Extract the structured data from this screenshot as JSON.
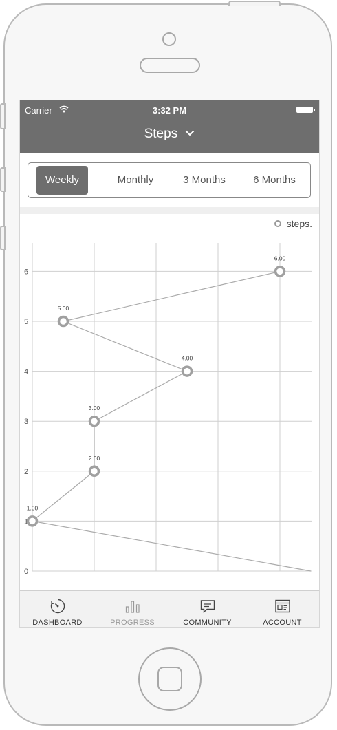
{
  "status_bar": {
    "carrier": "Carrier",
    "time": "3:32 PM"
  },
  "header": {
    "title": "Steps"
  },
  "range_tabs": [
    {
      "label": "Weekly",
      "active": true
    },
    {
      "label": "Monthly",
      "active": false
    },
    {
      "label": "3 Months",
      "active": false
    },
    {
      "label": "6 Months",
      "active": false
    }
  ],
  "chart_data": {
    "type": "line",
    "legend": "steps.",
    "x_lines": 5,
    "ylim": [
      0,
      6.5
    ],
    "yticks": [
      "0",
      "1",
      "2",
      "3",
      "4",
      "5",
      "6"
    ],
    "points": [
      {
        "x": 0,
        "y": 1,
        "label": "1.00"
      },
      {
        "x": 1,
        "y": 2,
        "label": "2.00"
      },
      {
        "x": 1,
        "y": 3,
        "label": "3.00"
      },
      {
        "x": 2.5,
        "y": 4,
        "label": "4.00"
      },
      {
        "x": 0.5,
        "y": 5,
        "label": "5.00"
      },
      {
        "x": 4,
        "y": 6,
        "label": "6.00"
      }
    ],
    "extra_segment": {
      "from": [
        0,
        1
      ],
      "to": [
        4.5,
        0
      ]
    },
    "colors": {
      "line": "#aaaaaa",
      "grid": "#cfcfcf",
      "marker": "#a0a0a0"
    }
  },
  "tabbar": {
    "items": [
      {
        "label": "DASHBOARD",
        "icon": "dashboard-icon"
      },
      {
        "label": "PROGRESS",
        "icon": "progress-bars-icon"
      },
      {
        "label": "COMMUNITY",
        "icon": "chat-bubble-icon"
      },
      {
        "label": "ACCOUNT",
        "icon": "account-card-icon"
      }
    ]
  }
}
